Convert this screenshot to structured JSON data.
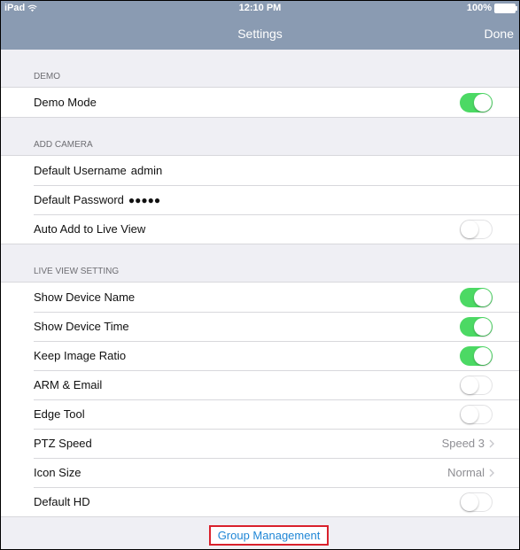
{
  "status_bar": {
    "device": "iPad",
    "time": "12:10 PM",
    "battery": "100%"
  },
  "nav": {
    "title": "Settings",
    "done_label": "Done"
  },
  "sections": {
    "demo": {
      "header": "DEMO",
      "demo_mode": {
        "label": "Demo Mode",
        "on": true
      }
    },
    "add_camera": {
      "header": "ADD CAMERA",
      "username": {
        "label": "Default Username",
        "value": "admin"
      },
      "password": {
        "label": "Default Password",
        "value": "●●●●●"
      },
      "auto_add": {
        "label": "Auto Add to Live View",
        "on": false
      }
    },
    "live_view": {
      "header": "LIVE VIEW SETTING",
      "show_device_name": {
        "label": "Show Device Name",
        "on": true
      },
      "show_device_time": {
        "label": "Show Device Time",
        "on": true
      },
      "keep_image_ratio": {
        "label": "Keep Image Ratio",
        "on": true
      },
      "arm_email": {
        "label": "ARM & Email",
        "on": false
      },
      "edge_tool": {
        "label": "Edge Tool",
        "on": false
      },
      "ptz_speed": {
        "label": "PTZ Speed",
        "value": "Speed 3"
      },
      "icon_size": {
        "label": "Icon Size",
        "value": "Normal"
      },
      "default_hd": {
        "label": "Default HD",
        "on": false
      }
    }
  },
  "group_management": {
    "label": "Group Management"
  },
  "colors": {
    "nav_bg": "#8a9bb2",
    "toggle_on": "#4cd964",
    "link": "#1f86d6",
    "highlight_border": "#d9212c"
  }
}
